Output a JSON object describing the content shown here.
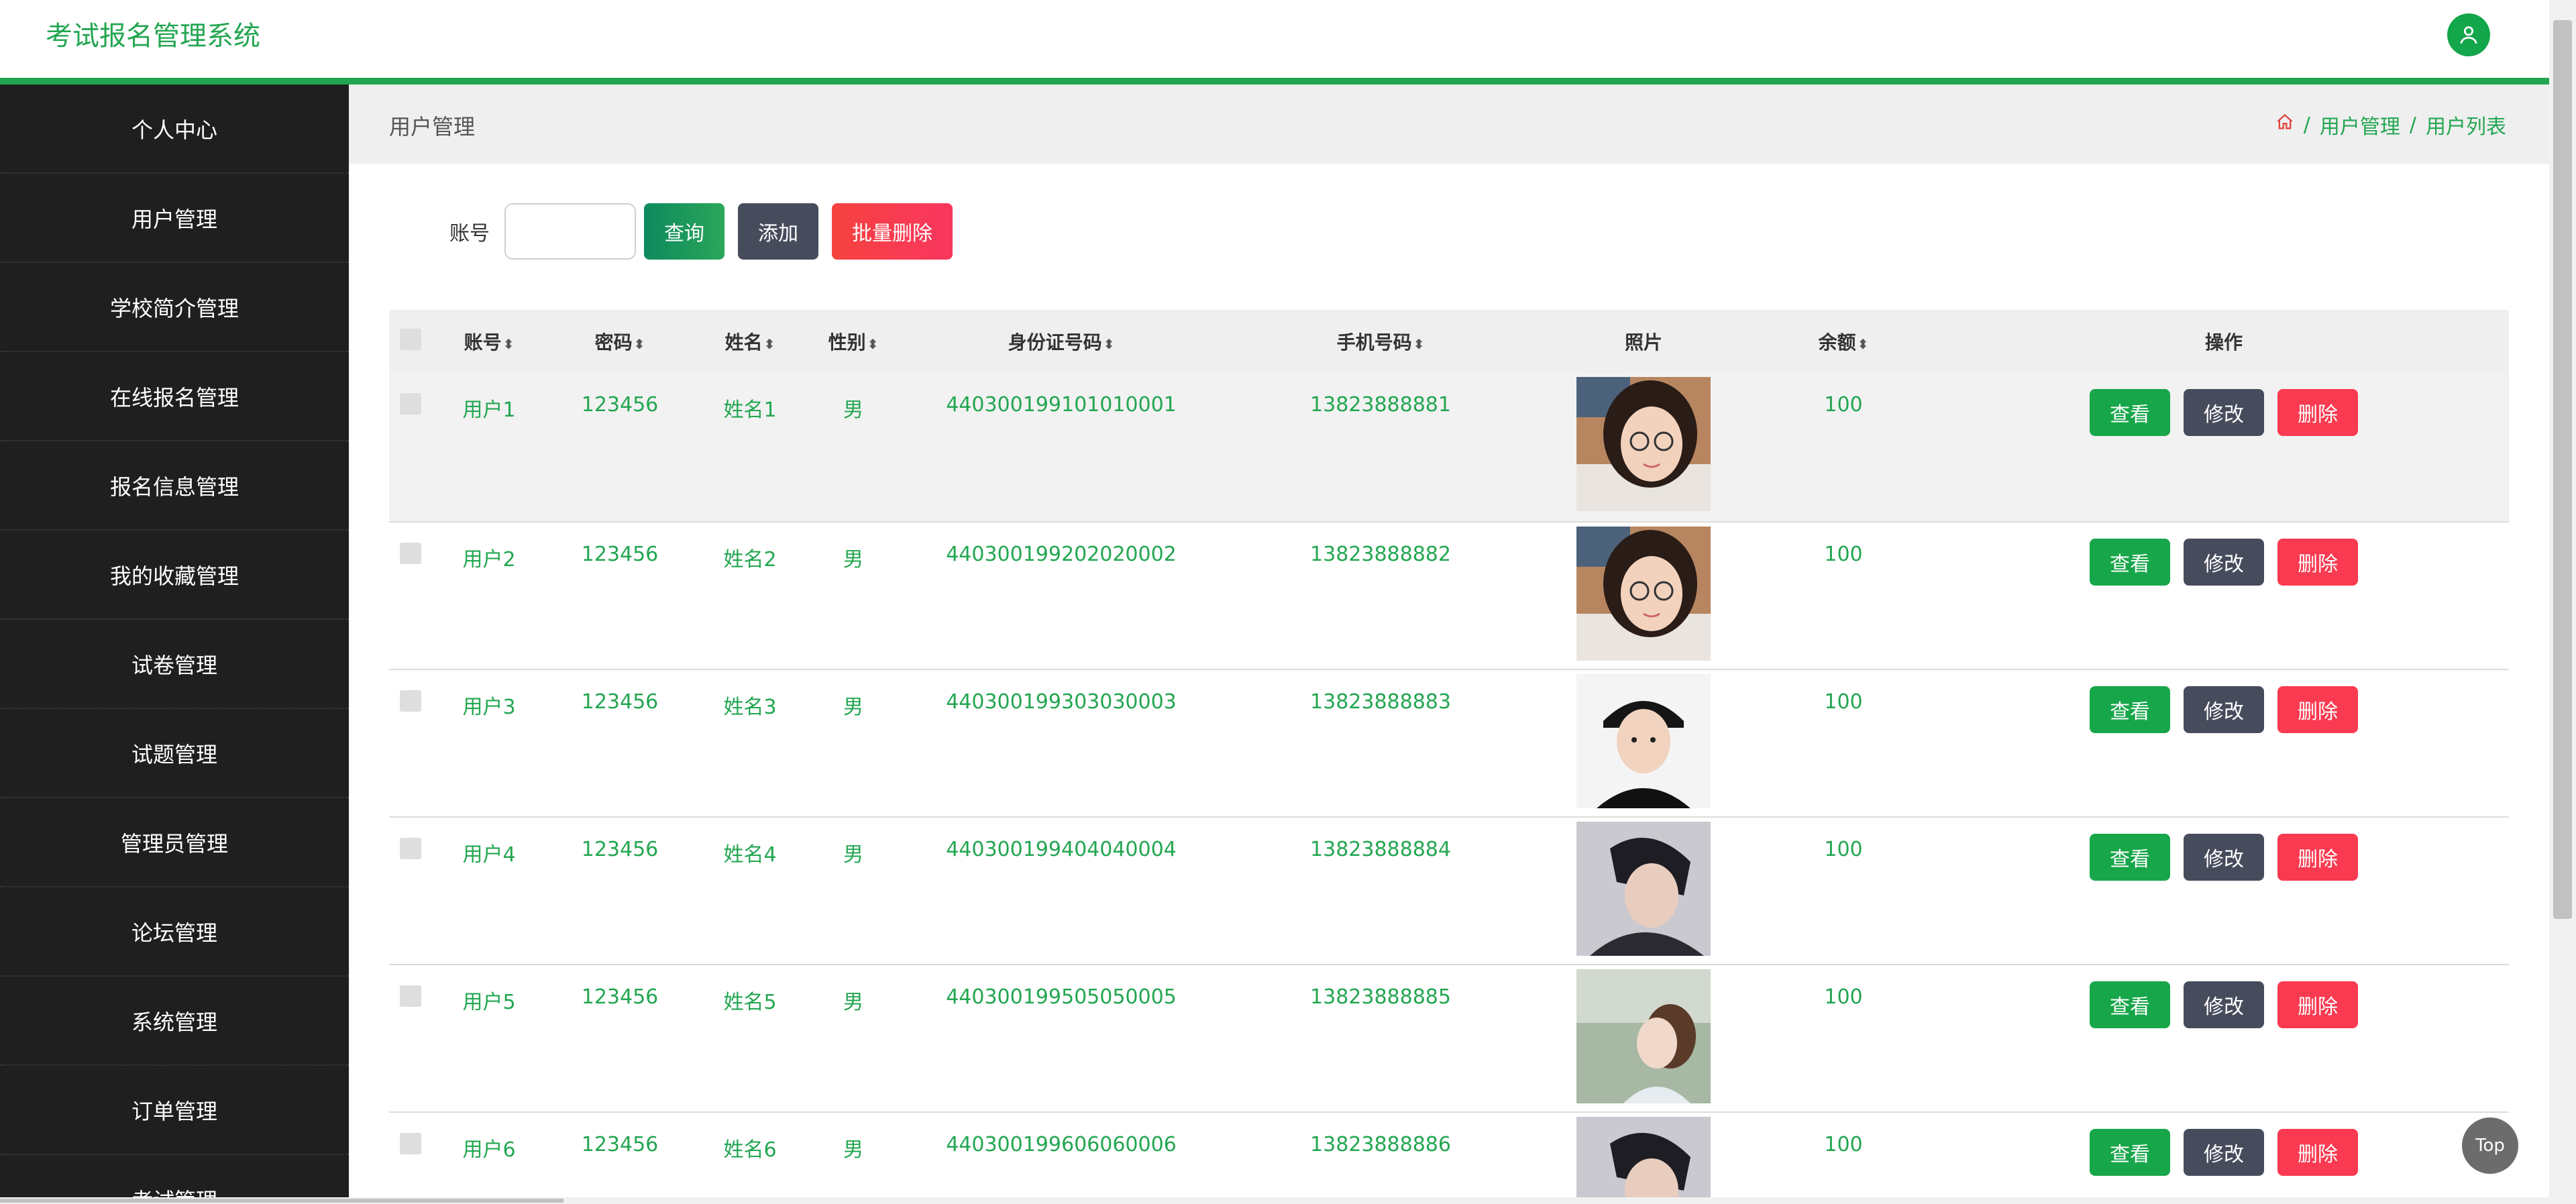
{
  "app": {
    "title": "考试报名管理系统"
  },
  "colors": {
    "accent": "#23a651",
    "sidebar_bg": "#1f1f1f",
    "danger": "#fa3a50",
    "dark_btn": "#474c5d"
  },
  "sidebar": {
    "items": [
      {
        "label": "个人中心"
      },
      {
        "label": "用户管理"
      },
      {
        "label": "学校简介管理"
      },
      {
        "label": "在线报名管理"
      },
      {
        "label": "报名信息管理"
      },
      {
        "label": "我的收藏管理"
      },
      {
        "label": "试卷管理"
      },
      {
        "label": "试题管理"
      },
      {
        "label": "管理员管理"
      },
      {
        "label": "论坛管理"
      },
      {
        "label": "系统管理"
      },
      {
        "label": "订单管理"
      },
      {
        "label": "考试管理"
      }
    ]
  },
  "breadcrumb": {
    "page_title": "用户管理",
    "home_icon": "home-icon",
    "items": [
      {
        "label": "用户管理"
      },
      {
        "label": "用户列表"
      }
    ],
    "separator": "/"
  },
  "search": {
    "label": "账号",
    "value": "",
    "placeholder": "",
    "query_label": "查询",
    "add_label": "添加",
    "batch_delete_label": "批量删除"
  },
  "table": {
    "columns": {
      "account": "账号",
      "password": "密码",
      "name": "姓名",
      "gender": "性别",
      "id_number": "身份证号码",
      "phone": "手机号码",
      "photo": "照片",
      "balance": "余额",
      "actions": "操作"
    },
    "rows": [
      {
        "account": "用户1",
        "password": "123456",
        "name": "姓名1",
        "gender": "男",
        "id_number": "440300199101010001",
        "phone": "13823888881",
        "balance": "100"
      },
      {
        "account": "用户2",
        "password": "123456",
        "name": "姓名2",
        "gender": "男",
        "id_number": "440300199202020002",
        "phone": "13823888882",
        "balance": "100"
      },
      {
        "account": "用户3",
        "password": "123456",
        "name": "姓名3",
        "gender": "男",
        "id_number": "440300199303030003",
        "phone": "13823888883",
        "balance": "100"
      },
      {
        "account": "用户4",
        "password": "123456",
        "name": "姓名4",
        "gender": "男",
        "id_number": "440300199404040004",
        "phone": "13823888884",
        "balance": "100"
      },
      {
        "account": "用户5",
        "password": "123456",
        "name": "姓名5",
        "gender": "男",
        "id_number": "440300199505050005",
        "phone": "13823888885",
        "balance": "100"
      },
      {
        "account": "用户6",
        "password": "123456",
        "name": "姓名6",
        "gender": "男",
        "id_number": "440300199606060006",
        "phone": "13823888886",
        "balance": "100"
      }
    ],
    "actions": {
      "view": "查看",
      "edit": "修改",
      "delete": "删除"
    }
  },
  "top_button": {
    "label": "Top"
  }
}
